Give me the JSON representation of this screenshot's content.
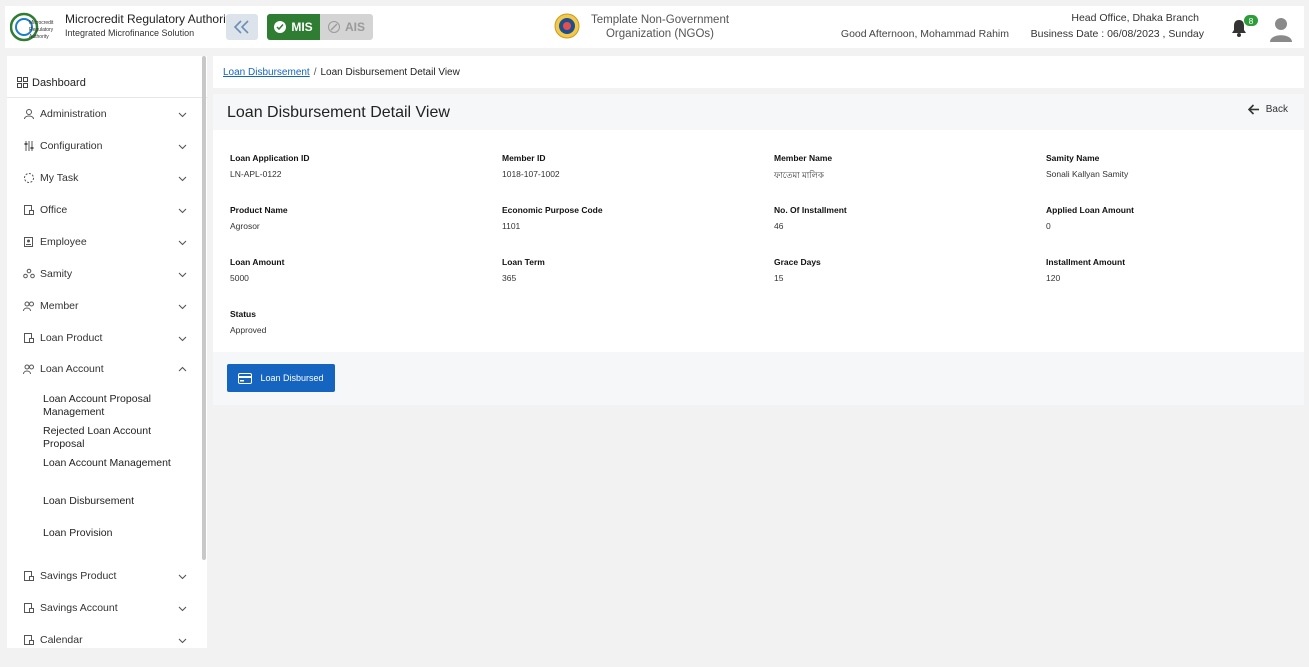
{
  "header": {
    "brand_title": "Microcredit Regulatory Authority",
    "brand_subtitle": "Integrated Microfinance Solution",
    "logo_text": [
      "Microcredit",
      "Regulatory",
      "Authority"
    ],
    "mode_mis": "MIS",
    "mode_ais": "AIS",
    "org_line1": "Template Non-Government",
    "org_line2": "Organization (NGOs)",
    "greeting": "Good Afternoon, Mohammad Rahim",
    "branch": "Head Office, Dhaka Branch",
    "business_date": "Business Date : 06/08/2023 , Sunday",
    "notification_count": "8"
  },
  "sidebar": {
    "dashboard": "Dashboard",
    "items": [
      {
        "label": "Administration",
        "icon": "admin-icon"
      },
      {
        "label": "Configuration",
        "icon": "config-icon"
      },
      {
        "label": "My Task",
        "icon": "task-icon"
      },
      {
        "label": "Office",
        "icon": "office-icon"
      },
      {
        "label": "Employee",
        "icon": "employee-icon"
      },
      {
        "label": "Samity",
        "icon": "samity-icon"
      },
      {
        "label": "Member",
        "icon": "member-icon"
      },
      {
        "label": "Loan Product",
        "icon": "loan-product-icon"
      },
      {
        "label": "Loan Account",
        "icon": "loan-account-icon"
      }
    ],
    "sub_items": [
      {
        "label": "Loan Account Proposal Management"
      },
      {
        "label": "Rejected Loan Account Proposal"
      },
      {
        "label": "Loan Account Management"
      },
      {
        "label": "Loan Disbursement"
      },
      {
        "label": "Loan Provision"
      }
    ],
    "items_after": [
      {
        "label": "Savings Product",
        "icon": "savings-product-icon"
      },
      {
        "label": "Savings Account",
        "icon": "savings-account-icon"
      },
      {
        "label": "Calendar",
        "icon": "calendar-icon"
      }
    ]
  },
  "breadcrumb": {
    "parent": "Loan Disbursement",
    "separator": "/",
    "current": "Loan Disbursement Detail View"
  },
  "page": {
    "title": "Loan Disbursement Detail View",
    "back_label": "Back",
    "action_label": "Loan Disbursed"
  },
  "fields": [
    {
      "label": "Loan Application ID",
      "value": "LN-APL-0122"
    },
    {
      "label": "Member ID",
      "value": "1018-107-1002"
    },
    {
      "label": "Member Name",
      "value": "ফাতেমা মালিক"
    },
    {
      "label": "Samity Name",
      "value": "Sonali Kallyan Samity"
    },
    {
      "label": "Product Name",
      "value": "Agrosor"
    },
    {
      "label": "Economic Purpose Code",
      "value": "1101"
    },
    {
      "label": "No. Of Installment",
      "value": "46"
    },
    {
      "label": "Applied Loan Amount",
      "value": "0"
    },
    {
      "label": "Loan Amount",
      "value": "5000"
    },
    {
      "label": "Loan Term",
      "value": "365"
    },
    {
      "label": "Grace Days",
      "value": "15"
    },
    {
      "label": "Installment Amount",
      "value": "120"
    },
    {
      "label": "Status",
      "value": "Approved"
    }
  ],
  "colors": {
    "primary": "#1565c0",
    "mis_green": "#2e7d32",
    "badge_green": "#2e9c3a"
  }
}
